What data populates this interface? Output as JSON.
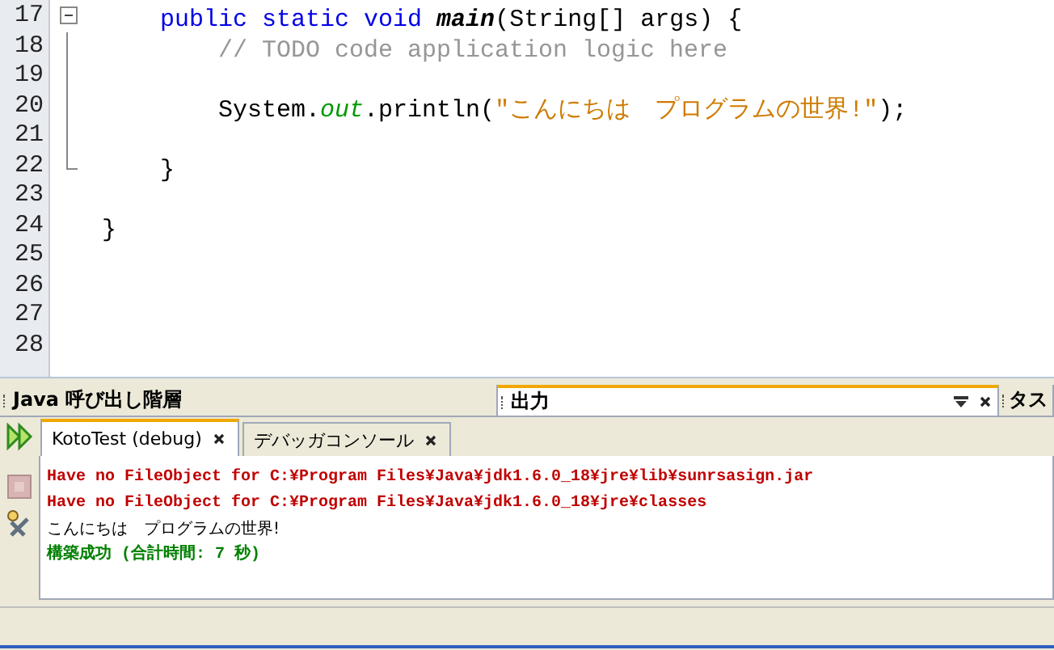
{
  "editor": {
    "lines": [
      {
        "number": "17",
        "expanded": true,
        "tokens": [
          {
            "text": "    public static void ",
            "kind": "keyword"
          },
          {
            "text": "main",
            "kind": "method"
          },
          {
            "text": "(String[] args) {",
            "kind": "plain"
          }
        ]
      },
      {
        "number": "18",
        "tokens": [
          {
            "text": "        // TODO code application logic here",
            "kind": "comment"
          }
        ]
      },
      {
        "number": "19"
      },
      {
        "number": "20",
        "tokens": [
          {
            "text": "        System.",
            "kind": "plain"
          },
          {
            "text": "out",
            "kind": "field"
          },
          {
            "text": ".println(",
            "kind": "plain"
          },
          {
            "text": "\"こんにちは　プログラムの世界!\"",
            "kind": "string"
          },
          {
            "text": ");",
            "kind": "plain"
          }
        ]
      },
      {
        "number": "21"
      },
      {
        "number": "22",
        "fold_end": true,
        "tokens": [
          {
            "text": "    }",
            "kind": "plain"
          }
        ]
      },
      {
        "number": "23"
      },
      {
        "number": "24",
        "tokens": [
          {
            "text": "}",
            "kind": "plain"
          }
        ]
      },
      {
        "number": "25"
      },
      {
        "number": "26"
      },
      {
        "number": "27"
      },
      {
        "number": "28"
      }
    ]
  },
  "panel_tabs": [
    {
      "label": "Java 呼び出し階層",
      "selected": false
    },
    {
      "label": "出力",
      "selected": true
    },
    {
      "label": "タス",
      "selected": false
    }
  ],
  "output": {
    "tabs": [
      {
        "label": "KotoTest (debug)",
        "selected": true
      },
      {
        "label": "デバッガコンソール",
        "selected": false
      }
    ],
    "lines": [
      {
        "text": "Have no FileObject for C:¥Program Files¥Java¥jdk1.6.0_18¥jre¥lib¥sunrsasign.jar",
        "kind": "error"
      },
      {
        "text": "Have no FileObject for C:¥Program Files¥Java¥jdk1.6.0_18¥jre¥classes",
        "kind": "error"
      },
      {
        "text": "こんにちは　プログラムの世界!",
        "kind": "plain"
      },
      {
        "text": "構築成功 (合計時間: 7 秒)",
        "kind": "success"
      }
    ]
  }
}
